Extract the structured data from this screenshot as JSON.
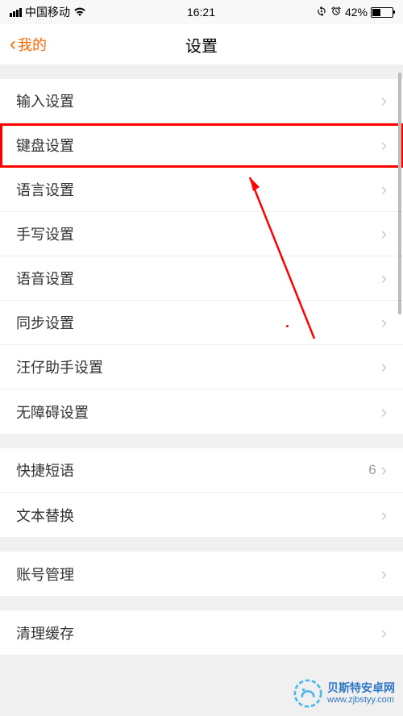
{
  "status": {
    "carrier": "中国移动",
    "time": "16:21",
    "battery_pct": "42%"
  },
  "nav": {
    "back_label": "我的",
    "title": "设置"
  },
  "groups": [
    {
      "rows": [
        {
          "label": "输入设置",
          "value": "",
          "highlighted": false
        },
        {
          "label": "键盘设置",
          "value": "",
          "highlighted": true
        },
        {
          "label": "语言设置",
          "value": "",
          "highlighted": false
        },
        {
          "label": "手写设置",
          "value": "",
          "highlighted": false
        },
        {
          "label": "语音设置",
          "value": "",
          "highlighted": false
        },
        {
          "label": "同步设置",
          "value": "",
          "highlighted": false
        },
        {
          "label": "汪仔助手设置",
          "value": "",
          "highlighted": false
        },
        {
          "label": "无障碍设置",
          "value": "",
          "highlighted": false
        }
      ]
    },
    {
      "rows": [
        {
          "label": "快捷短语",
          "value": "6",
          "highlighted": false
        },
        {
          "label": "文本替换",
          "value": "",
          "highlighted": false
        }
      ]
    },
    {
      "rows": [
        {
          "label": "账号管理",
          "value": "",
          "highlighted": false
        }
      ]
    },
    {
      "rows": [
        {
          "label": "清理缓存",
          "value": "",
          "highlighted": false
        }
      ]
    }
  ],
  "watermark": {
    "title": "贝斯特安卓网",
    "url": "www.zjbstyy.com"
  }
}
